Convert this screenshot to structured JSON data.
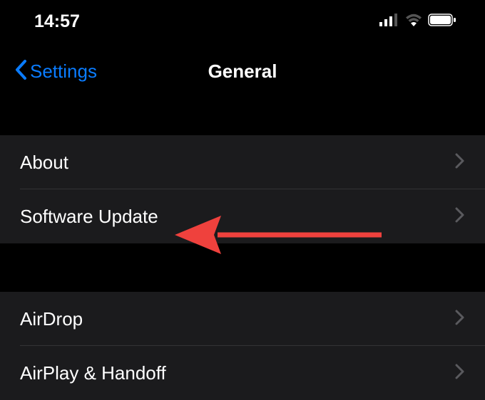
{
  "statusBar": {
    "time": "14:57"
  },
  "nav": {
    "backLabel": "Settings",
    "title": "General"
  },
  "group1": {
    "items": [
      {
        "label": "About"
      },
      {
        "label": "Software Update"
      }
    ]
  },
  "group2": {
    "items": [
      {
        "label": "AirDrop"
      },
      {
        "label": "AirPlay & Handoff"
      }
    ]
  }
}
